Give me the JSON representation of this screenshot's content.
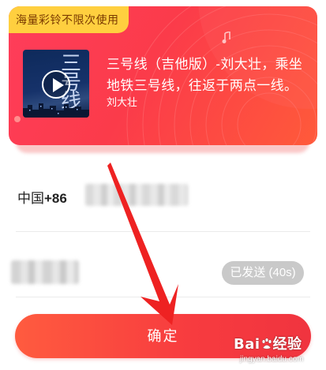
{
  "card": {
    "badge": "海量彩铃不限次使用",
    "song_title": "三号线（吉他版）-刘大壮，乘坐地铁三号线，往返于两点一线。",
    "artist": "刘大壮",
    "cover_text": "三号线"
  },
  "form": {
    "country_name": "中国",
    "country_code": "+86",
    "sent_button": "已发送 (40s)",
    "confirm_button": "确定"
  },
  "watermark": {
    "logo_a": "Bai",
    "logo_b": "经验",
    "url": "jingyan.baidu.com"
  },
  "colors": {
    "accent": "#f73b3f",
    "badge_bg": "#ffcf3f",
    "disabled": "#c9c9c9",
    "annotation_arrow": "#ee2222"
  },
  "icons": [
    "music-note-icon",
    "play-icon",
    "baidu-paw-icon"
  ]
}
